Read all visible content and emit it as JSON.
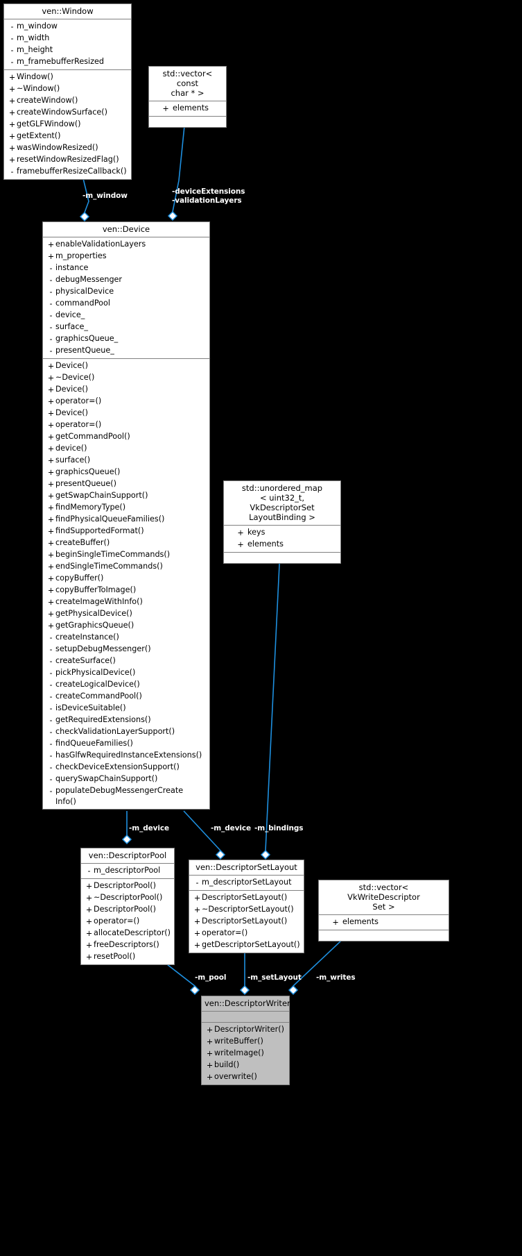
{
  "diagram": {
    "type": "uml-class-collaboration-diagram",
    "background_color": "#000000",
    "node_fill": "#ffffff",
    "node_border": "#808080",
    "edge_color": "#1e90e0",
    "highlight_fill": "#bfbfbf",
    "label_color": "#ffffff"
  },
  "nodes": {
    "window": {
      "title": "ven::Window",
      "attributes": [
        {
          "vis": "-",
          "name": "m_window"
        },
        {
          "vis": "-",
          "name": "m_width"
        },
        {
          "vis": "-",
          "name": "m_height"
        },
        {
          "vis": "-",
          "name": "m_framebufferResized"
        }
      ],
      "methods": [
        {
          "vis": "+",
          "name": "Window()"
        },
        {
          "vis": "+",
          "name": "~Window()"
        },
        {
          "vis": "+",
          "name": "createWindow()"
        },
        {
          "vis": "+",
          "name": "createWindowSurface()"
        },
        {
          "vis": "+",
          "name": "getGLFWindow()"
        },
        {
          "vis": "+",
          "name": "getExtent()"
        },
        {
          "vis": "+",
          "name": "wasWindowResized()"
        },
        {
          "vis": "+",
          "name": "resetWindowResizedFlag()"
        },
        {
          "vis": "-",
          "name": "framebufferResizeCallback()"
        }
      ]
    },
    "vector_const_char": {
      "title": "std::vector< const\nchar * >",
      "attributes": [
        {
          "vis": "+",
          "name": "elements"
        }
      ],
      "methods": []
    },
    "device": {
      "title": "ven::Device",
      "attributes": [
        {
          "vis": "+",
          "name": "enableValidationLayers"
        },
        {
          "vis": "+",
          "name": "m_properties"
        },
        {
          "vis": "-",
          "name": "instance"
        },
        {
          "vis": "-",
          "name": "debugMessenger"
        },
        {
          "vis": "-",
          "name": "physicalDevice"
        },
        {
          "vis": "-",
          "name": "commandPool"
        },
        {
          "vis": "-",
          "name": "device_"
        },
        {
          "vis": "-",
          "name": "surface_"
        },
        {
          "vis": "-",
          "name": "graphicsQueue_"
        },
        {
          "vis": "-",
          "name": "presentQueue_"
        }
      ],
      "methods": [
        {
          "vis": "+",
          "name": "Device()"
        },
        {
          "vis": "+",
          "name": "~Device()"
        },
        {
          "vis": "+",
          "name": "Device()"
        },
        {
          "vis": "+",
          "name": "operator=()"
        },
        {
          "vis": "+",
          "name": "Device()"
        },
        {
          "vis": "+",
          "name": "operator=()"
        },
        {
          "vis": "+",
          "name": "getCommandPool()"
        },
        {
          "vis": "+",
          "name": "device()"
        },
        {
          "vis": "+",
          "name": "surface()"
        },
        {
          "vis": "+",
          "name": "graphicsQueue()"
        },
        {
          "vis": "+",
          "name": "presentQueue()"
        },
        {
          "vis": "+",
          "name": "getSwapChainSupport()"
        },
        {
          "vis": "+",
          "name": "findMemoryType()"
        },
        {
          "vis": "+",
          "name": "findPhysicalQueueFamilies()"
        },
        {
          "vis": "+",
          "name": "findSupportedFormat()"
        },
        {
          "vis": "+",
          "name": "createBuffer()"
        },
        {
          "vis": "+",
          "name": "beginSingleTimeCommands()"
        },
        {
          "vis": "+",
          "name": "endSingleTimeCommands()"
        },
        {
          "vis": "+",
          "name": "copyBuffer()"
        },
        {
          "vis": "+",
          "name": "copyBufferToImage()"
        },
        {
          "vis": "+",
          "name": "createImageWithInfo()"
        },
        {
          "vis": "+",
          "name": "getPhysicalDevice()"
        },
        {
          "vis": "+",
          "name": "getGraphicsQueue()"
        },
        {
          "vis": "-",
          "name": "createInstance()"
        },
        {
          "vis": "-",
          "name": "setupDebugMessenger()"
        },
        {
          "vis": "-",
          "name": "createSurface()"
        },
        {
          "vis": "-",
          "name": "pickPhysicalDevice()"
        },
        {
          "vis": "-",
          "name": "createLogicalDevice()"
        },
        {
          "vis": "-",
          "name": "createCommandPool()"
        },
        {
          "vis": "-",
          "name": "isDeviceSuitable()"
        },
        {
          "vis": "-",
          "name": "getRequiredExtensions()"
        },
        {
          "vis": "-",
          "name": "checkValidationLayerSupport()"
        },
        {
          "vis": "-",
          "name": "findQueueFamilies()"
        },
        {
          "vis": "-",
          "name": "hasGlfwRequiredInstanceExtensions()"
        },
        {
          "vis": "-",
          "name": "checkDeviceExtensionSupport()"
        },
        {
          "vis": "-",
          "name": "querySwapChainSupport()"
        },
        {
          "vis": "-",
          "name": "populateDebugMessengerCreate\nInfo()"
        }
      ]
    },
    "unordered_map": {
      "title": "std::unordered_map\n< uint32_t, VkDescriptorSet\nLayoutBinding >",
      "attributes": [
        {
          "vis": "+",
          "name": "keys"
        },
        {
          "vis": "+",
          "name": "elements"
        }
      ],
      "methods": []
    },
    "descriptor_pool": {
      "title": "ven::DescriptorPool",
      "attributes": [
        {
          "vis": "-",
          "name": "m_descriptorPool"
        }
      ],
      "methods": [
        {
          "vis": "+",
          "name": "DescriptorPool()"
        },
        {
          "vis": "+",
          "name": "~DescriptorPool()"
        },
        {
          "vis": "+",
          "name": "DescriptorPool()"
        },
        {
          "vis": "+",
          "name": "operator=()"
        },
        {
          "vis": "+",
          "name": "allocateDescriptor()"
        },
        {
          "vis": "+",
          "name": "freeDescriptors()"
        },
        {
          "vis": "+",
          "name": "resetPool()"
        }
      ]
    },
    "descriptor_set_layout": {
      "title": "ven::DescriptorSetLayout",
      "attributes": [
        {
          "vis": "-",
          "name": "m_descriptorSetLayout"
        }
      ],
      "methods": [
        {
          "vis": "+",
          "name": "DescriptorSetLayout()"
        },
        {
          "vis": "+",
          "name": "~DescriptorSetLayout()"
        },
        {
          "vis": "+",
          "name": "DescriptorSetLayout()"
        },
        {
          "vis": "+",
          "name": "operator=()"
        },
        {
          "vis": "+",
          "name": "getDescriptorSetLayout()"
        }
      ]
    },
    "vector_write_descriptor": {
      "title": "std::vector< VkWriteDescriptor\nSet >",
      "attributes": [
        {
          "vis": "+",
          "name": "elements"
        }
      ],
      "methods": []
    },
    "descriptor_writer": {
      "title": "ven::DescriptorWriter",
      "attributes": [],
      "methods": [
        {
          "vis": "+",
          "name": "DescriptorWriter()"
        },
        {
          "vis": "+",
          "name": "writeBuffer()"
        },
        {
          "vis": "+",
          "name": "writeImage()"
        },
        {
          "vis": "+",
          "name": "build()"
        },
        {
          "vis": "+",
          "name": "overwrite()"
        }
      ]
    }
  },
  "edge_labels": {
    "window_to_device": "-m_window",
    "vector_to_device": "-deviceExtensions\n-validationLayers",
    "device_to_pool": "-m_device",
    "device_to_setlayout": "-m_device",
    "map_to_setlayout": "-m_bindings",
    "pool_to_writer": "-m_pool",
    "setlayout_to_writer": "-m_setLayout",
    "vectorwrite_to_writer": "-m_writes"
  }
}
